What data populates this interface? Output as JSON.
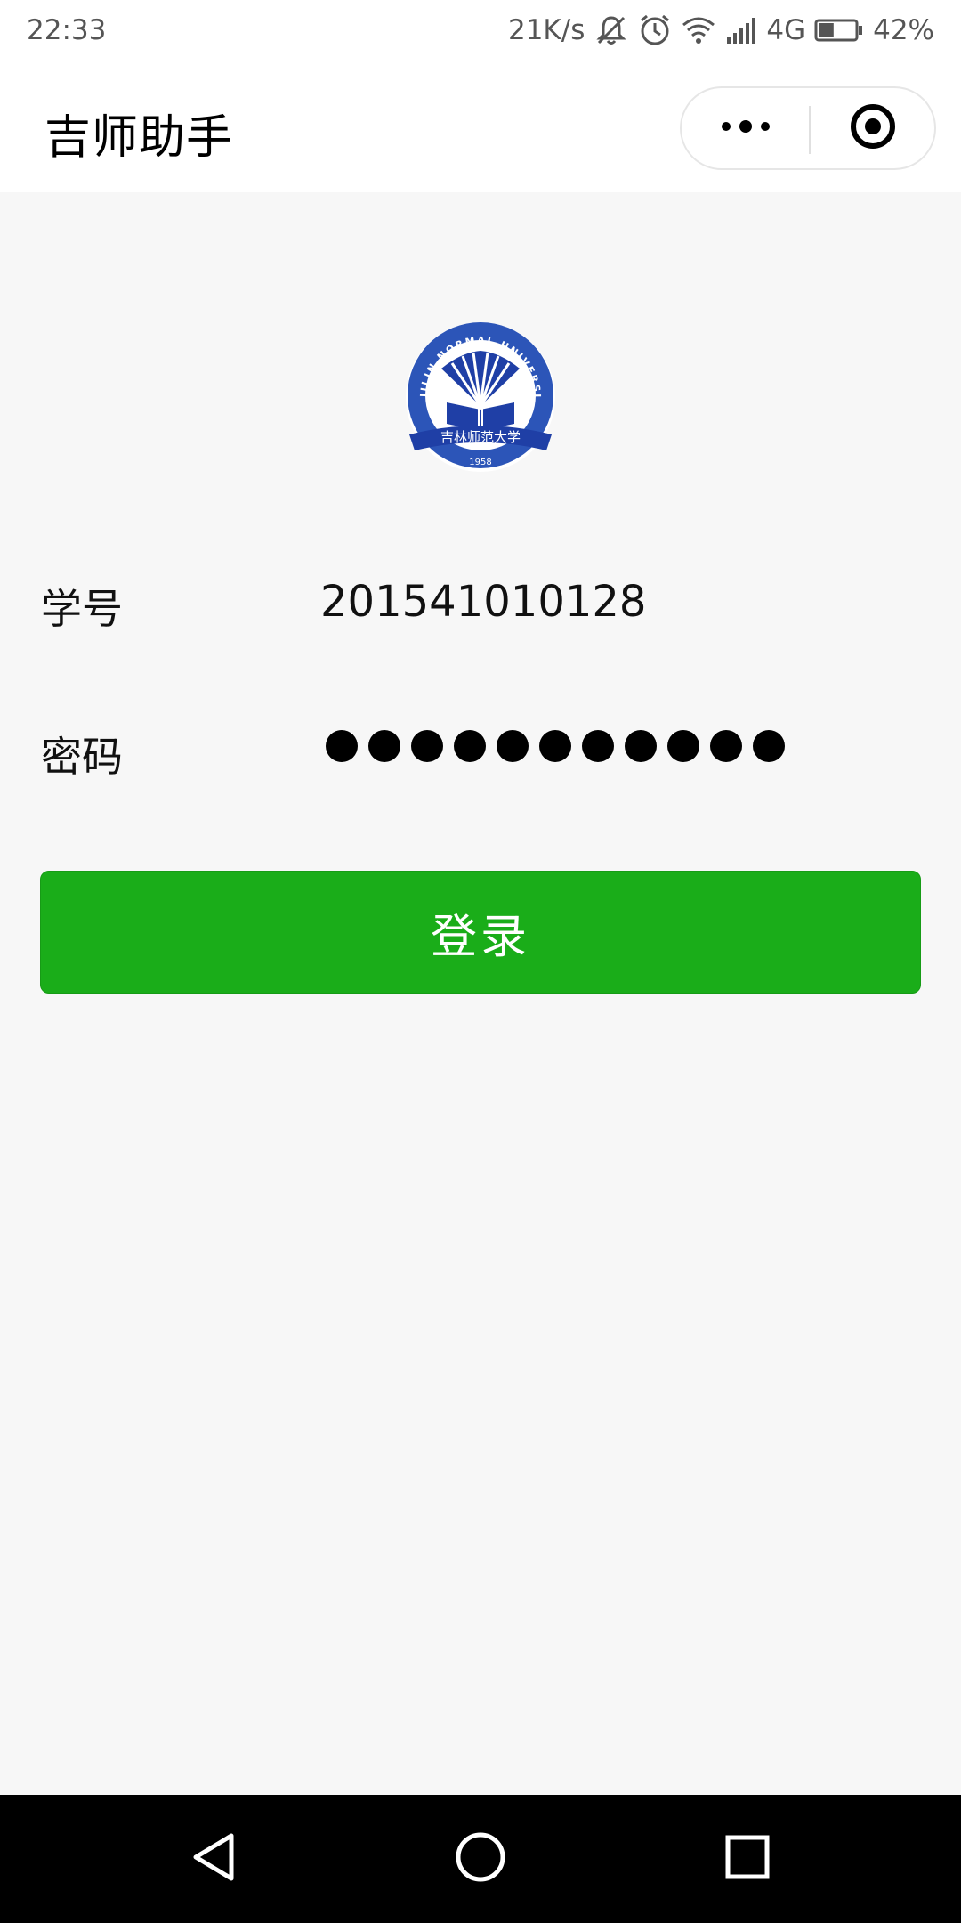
{
  "status_bar": {
    "time": "22:33",
    "network_speed": "21K/s",
    "network_type": "4G",
    "battery": "42%",
    "battery_level": 0.42,
    "icons": [
      "mute-icon",
      "alarm-icon",
      "wifi-icon",
      "signal-icon",
      "battery-icon"
    ]
  },
  "nav": {
    "title": "吉师助手",
    "more_icon": "more-dots-icon",
    "close_icon": "target-close-icon"
  },
  "logo": {
    "text_ring": "JILIN NORMAL UNIVERSITY",
    "year": "1958",
    "banner": "吉林师范大学",
    "colors": {
      "blue": "#1f3fa6",
      "ring": "#2c55b8",
      "white": "#ffffff"
    }
  },
  "form": {
    "id_label": "学号",
    "id_value": "201541010128",
    "password_label": "密码",
    "password_length": 11
  },
  "login": {
    "label": "登录",
    "color": "#1aad19"
  },
  "system_nav": {
    "back_icon": "back-triangle-icon",
    "home_icon": "home-circle-icon",
    "recent_icon": "recent-square-icon"
  }
}
